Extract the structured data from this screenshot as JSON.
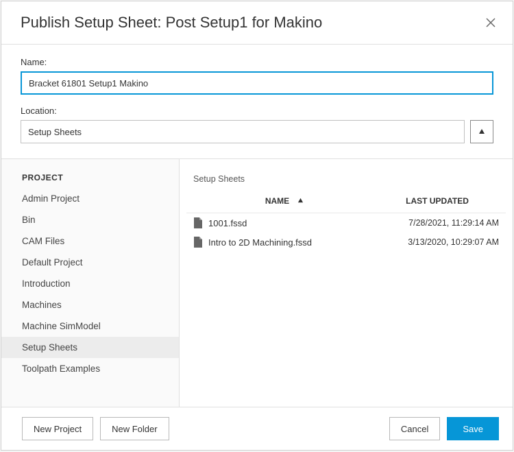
{
  "dialog": {
    "title": "Publish Setup Sheet: Post Setup1 for Makino"
  },
  "form": {
    "name_label": "Name:",
    "name_value": "Bracket 61801 Setup1 Makino",
    "location_label": "Location:",
    "location_value": "Setup Sheets"
  },
  "sidebar": {
    "heading": "PROJECT",
    "items": [
      {
        "label": "Admin Project",
        "selected": false
      },
      {
        "label": "Bin",
        "selected": false
      },
      {
        "label": "CAM Files",
        "selected": false
      },
      {
        "label": "Default Project",
        "selected": false
      },
      {
        "label": "Introduction",
        "selected": false
      },
      {
        "label": "Machines",
        "selected": false
      },
      {
        "label": "Machine SimModel",
        "selected": false
      },
      {
        "label": "Setup Sheets",
        "selected": true
      },
      {
        "label": "Toolpath Examples",
        "selected": false
      }
    ]
  },
  "content": {
    "breadcrumb": "Setup Sheets",
    "columns": {
      "name": "NAME",
      "updated": "LAST UPDATED"
    },
    "files": [
      {
        "name": "1001.fssd",
        "updated": "7/28/2021, 11:29:14 AM"
      },
      {
        "name": "Intro to 2D Machining.fssd",
        "updated": "3/13/2020, 10:29:07 AM"
      }
    ]
  },
  "footer": {
    "new_project": "New Project",
    "new_folder": "New Folder",
    "cancel": "Cancel",
    "save": "Save"
  }
}
